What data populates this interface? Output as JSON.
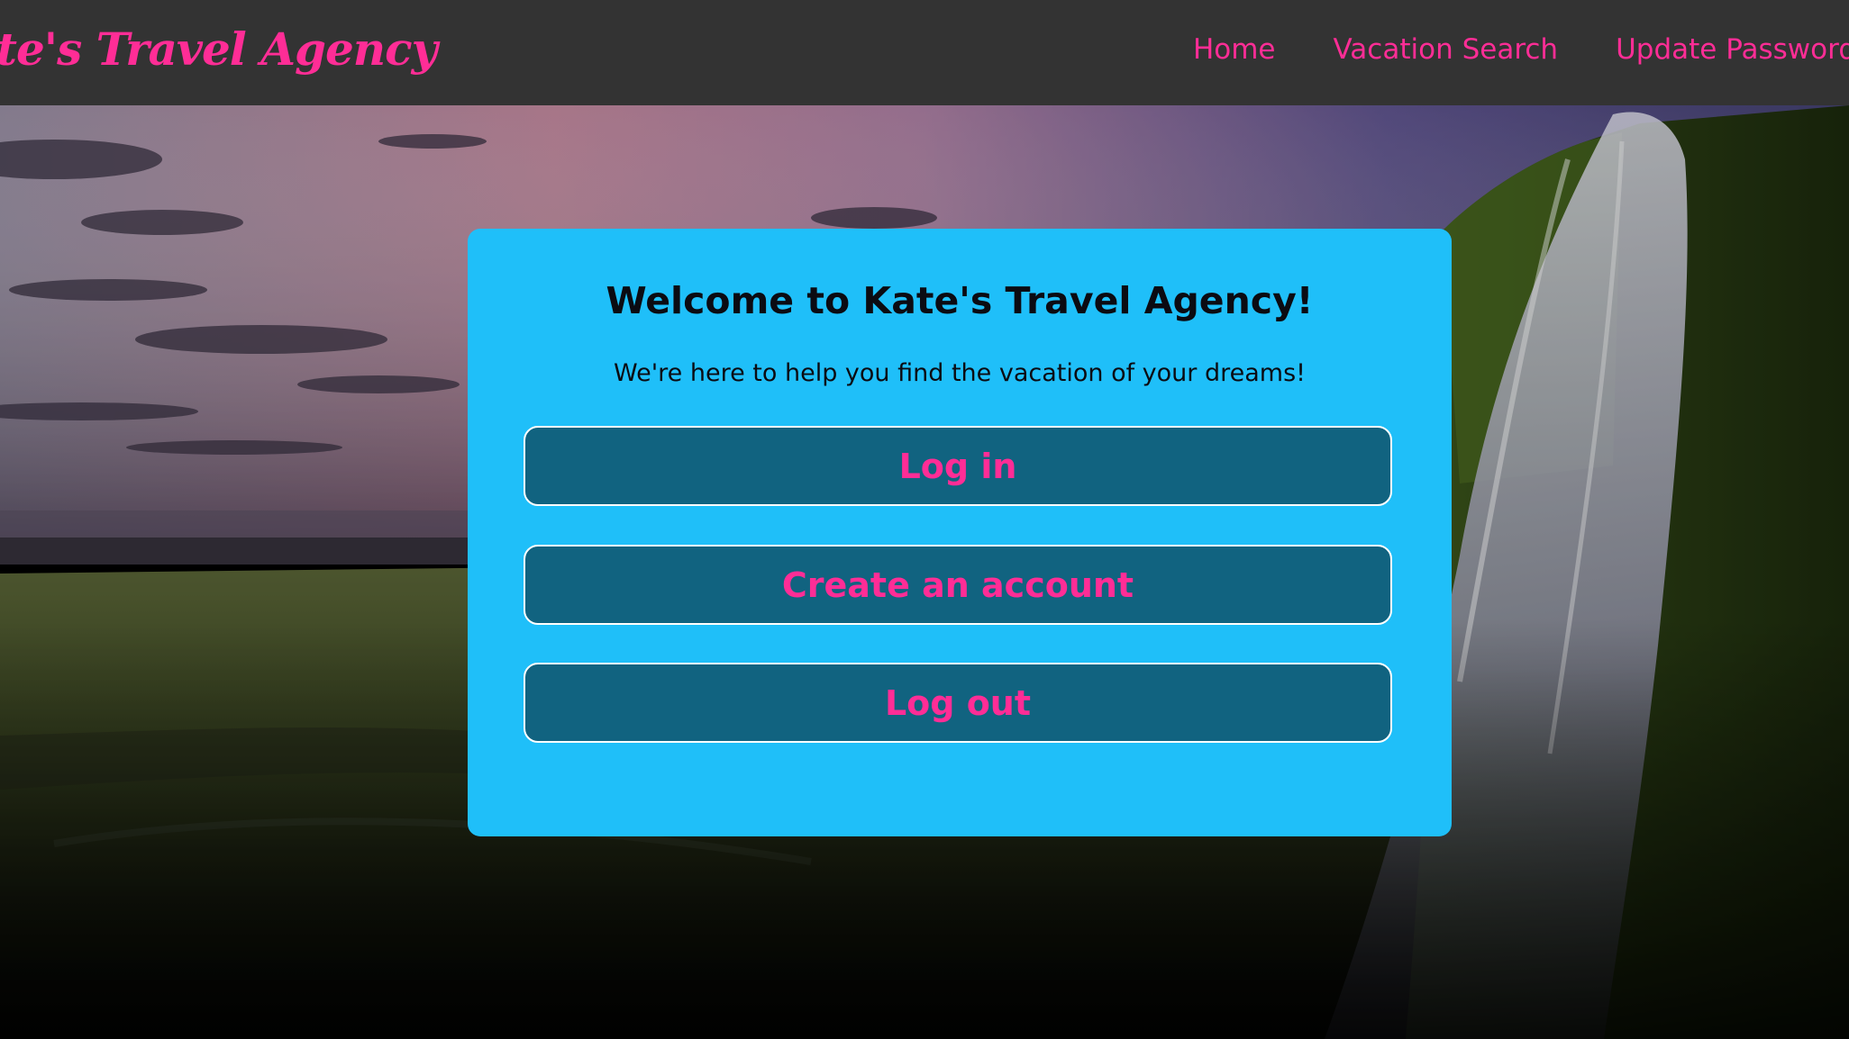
{
  "navbar": {
    "brand": "Kate's Travel Agency",
    "links": [
      {
        "label": "Home"
      },
      {
        "label": "Vacation Search"
      },
      {
        "label": "Update Password"
      }
    ]
  },
  "card": {
    "title": "Welcome to Kate's Travel Agency!",
    "subtitle": "We're here to help you find the vacation of your dreams!",
    "buttons": {
      "login": "Log in",
      "create_account": "Create an account",
      "logout": "Log out"
    }
  },
  "colors": {
    "navbar_bg": "#333333",
    "accent_pink": "#ff2d96",
    "card_bg": "#1fbff9",
    "button_bg": "#116380",
    "button_border": "#ffffff"
  },
  "background": {
    "description_icon": "waterfall-landscape-image"
  }
}
